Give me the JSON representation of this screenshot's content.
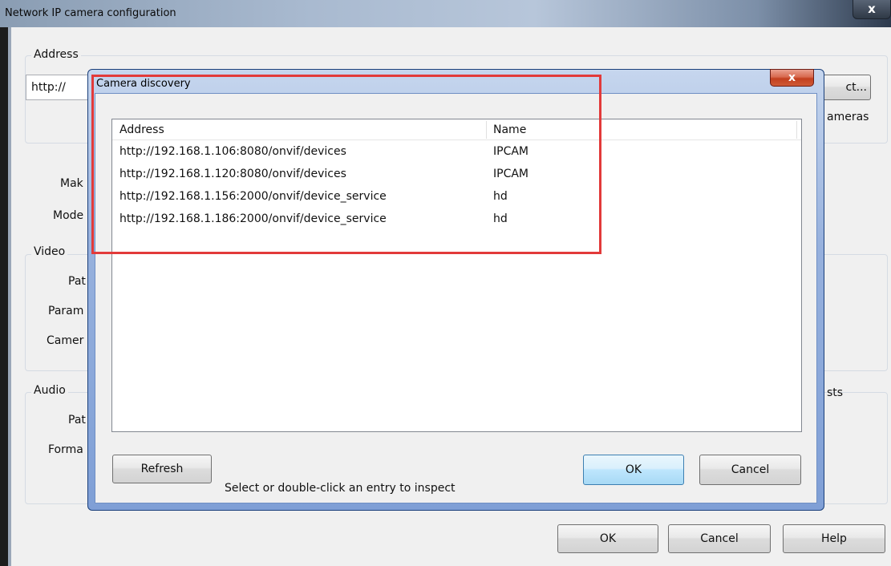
{
  "outer": {
    "title": "Network IP camera configuration",
    "close_glyph": "x",
    "address_group_label": "Address",
    "address_prefix": "http://",
    "select_button_partial": "ct...",
    "cameras_partial": "ameras",
    "make_label_partial": "Mak",
    "model_label_partial": "Mode",
    "video_group_label": "Video",
    "video_path_partial": "Pat",
    "video_params_partial": "Param",
    "video_camera_partial": "Camer",
    "audio_group_label": "Audio",
    "audio_path_partial": "Pat",
    "audio_format_partial": "Forma",
    "sts_partial": "sts",
    "ok_label": "OK",
    "cancel_label": "Cancel",
    "help_label": "Help"
  },
  "dialog": {
    "title": "Camera discovery",
    "close_glyph": "x",
    "columns": [
      "Address",
      "Name"
    ],
    "rows": [
      {
        "address": "http://192.168.1.106:8080/onvif/devices",
        "name": "IPCAM"
      },
      {
        "address": "http://192.168.1.120:8080/onvif/devices",
        "name": "IPCAM"
      },
      {
        "address": "http://192.168.1.156:2000/onvif/device_service",
        "name": "hd"
      },
      {
        "address": "http://192.168.1.186:2000/onvif/device_service",
        "name": "hd"
      }
    ],
    "refresh_label": "Refresh",
    "status_text": "Select or double-click an entry to inspect",
    "ok_label": "OK",
    "cancel_label": "Cancel"
  },
  "colors": {
    "highlight": "#e23a3a",
    "dialog_frame": "#7f9fd6",
    "close_button": "#c3401f"
  }
}
